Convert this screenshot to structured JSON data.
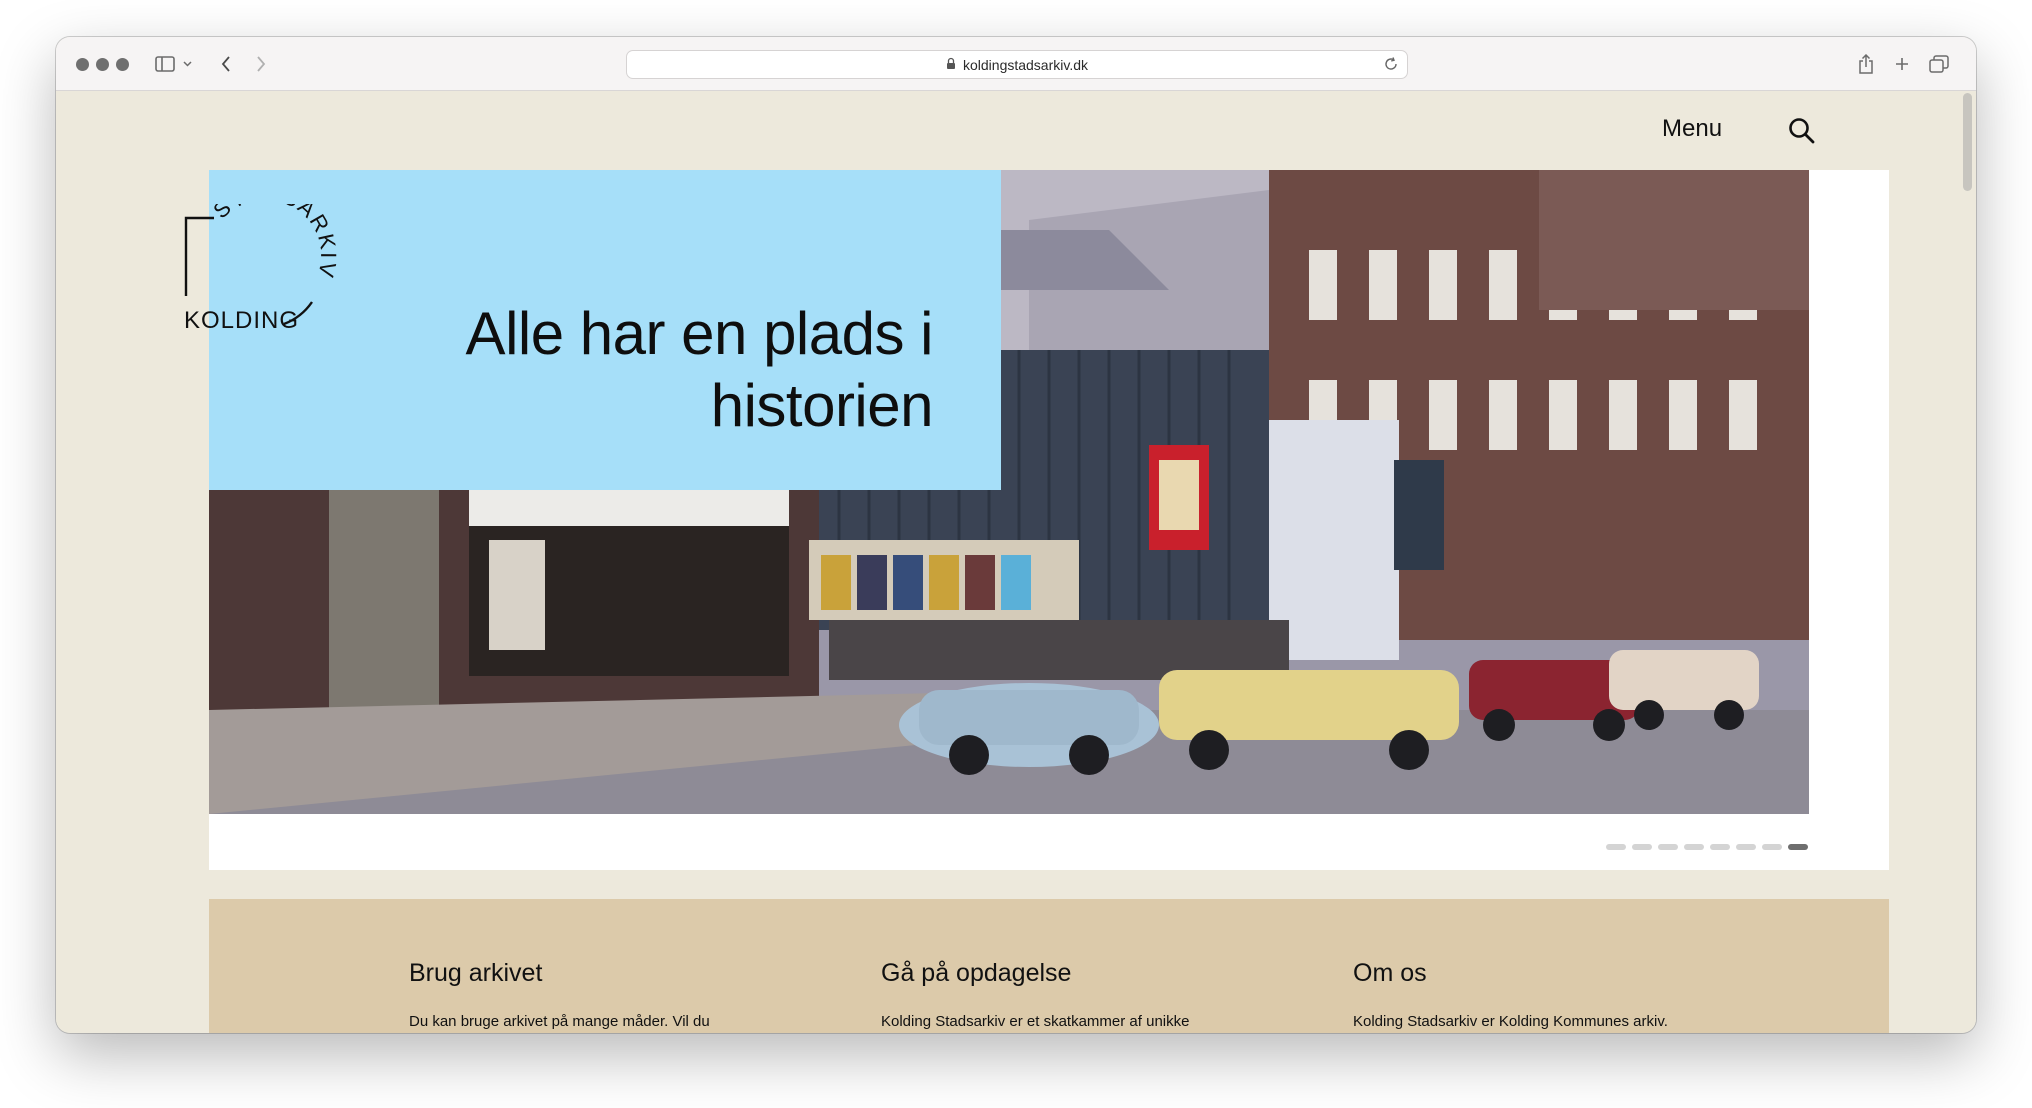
{
  "browser": {
    "url": "koldingstadsarkiv.dk"
  },
  "header": {
    "menu_label": "Menu"
  },
  "hero": {
    "title_line1": "Alle har en plads i",
    "title_line2": "historien"
  },
  "logo": {
    "line1": "STADSARKIV",
    "line2": "KOLDING"
  },
  "carousel": {
    "slide_count": 8,
    "active_index": 7
  },
  "info": {
    "columns": [
      {
        "heading": "Brug arkivet",
        "text": "Du kan bruge arkivet på mange måder. Vil du vide mere om din slægt eller hvor du bor, så"
      },
      {
        "heading": "Gå på opdagelse",
        "text": "Kolding Stadsarkiv er et skatkammer af unikke dokumenter, fotografier, fortællinger"
      },
      {
        "heading": "Om os",
        "text": "Kolding Stadsarkiv er Kolding Kommunes arkiv. Vi er både dokumentationscenter og"
      }
    ]
  },
  "colors": {
    "page_bg": "#ede9dc",
    "hero_box": "#a6dff9",
    "info_bg": "#dccaaa"
  }
}
